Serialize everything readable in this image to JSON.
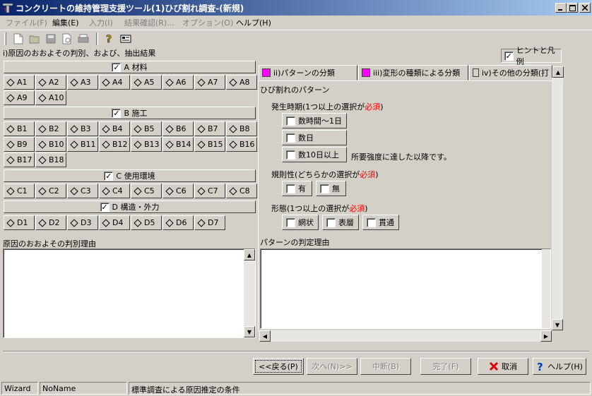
{
  "window": {
    "title": "コンクリートの維持管理支援ツール(1)ひび割れ調査-(新規)"
  },
  "menu": [
    {
      "label": "ファイル(F)",
      "enabled": false
    },
    {
      "label": "編集(E)",
      "enabled": true
    },
    {
      "label": "入力(I)",
      "enabled": false
    },
    {
      "label": "結果確認(R)...",
      "enabled": false
    },
    {
      "label": "オプション(O)",
      "enabled": false
    },
    {
      "label": "ヘルプ(H)",
      "enabled": true
    }
  ],
  "left": {
    "section_title": "i)原因のおおよその判別、および、抽出結果",
    "groups": [
      {
        "label": "A 材料",
        "checked": true,
        "items": [
          "A1",
          "A2",
          "A3",
          "A4",
          "A5",
          "A6",
          "A7",
          "A8",
          "A9",
          "A10"
        ]
      },
      {
        "label": "B 施工",
        "checked": true,
        "items": [
          "B1",
          "B2",
          "B3",
          "B4",
          "B5",
          "B6",
          "B7",
          "B8",
          "B9",
          "B10",
          "B11",
          "B12",
          "B13",
          "B14",
          "B15",
          "B16",
          "B17",
          "B18"
        ]
      },
      {
        "label": "C 使用環境",
        "checked": true,
        "items": [
          "C1",
          "C2",
          "C3",
          "C4",
          "C5",
          "C6",
          "C7",
          "C8"
        ]
      },
      {
        "label": "D 構造・外力",
        "checked": true,
        "items": [
          "D1",
          "D2",
          "D3",
          "D4",
          "D5",
          "D6",
          "D7"
        ]
      }
    ],
    "reason_label": "原因のおおよその判別理由"
  },
  "hint": {
    "label": "ヒントと凡例",
    "checked": true
  },
  "tabs": [
    {
      "label": "ii)パターンの分類",
      "color": "#ff00ff"
    },
    {
      "label": "iii)変形の種類による分類",
      "color": "#ff00ff"
    },
    {
      "label": "iv)その他の分類(打",
      "color": "#d4d0c8"
    }
  ],
  "pattern": {
    "heading": "ひび割れのパターン",
    "timing": {
      "label_prefix": "発生時期(1つ以上の選択が",
      "label_required": "必須",
      "label_suffix": ")",
      "options": [
        "数時間〜1日",
        "数日",
        "数10日以上"
      ],
      "note": "所要強度に達した以降です。"
    },
    "regularity": {
      "label_prefix": "規則性(どちらかの選択が",
      "label_required": "必須",
      "label_suffix": ")",
      "options": [
        "有",
        "無"
      ]
    },
    "form": {
      "label_prefix": "形態(1つ以上の選択が",
      "label_required": "必須",
      "label_suffix": ")",
      "options": [
        "網状",
        "表層",
        "貫通"
      ]
    },
    "reason_label": "パターンの判定理由"
  },
  "buttons": {
    "back": "<<戻る(P)",
    "next": "次へ(N)>>",
    "suspend": "中断(B)",
    "finish": "完了(F)",
    "cancel": "取消",
    "help": "ヘルプ(H)"
  },
  "status": [
    "Wizard",
    "NoName",
    "標準調査による原因推定の条件"
  ]
}
